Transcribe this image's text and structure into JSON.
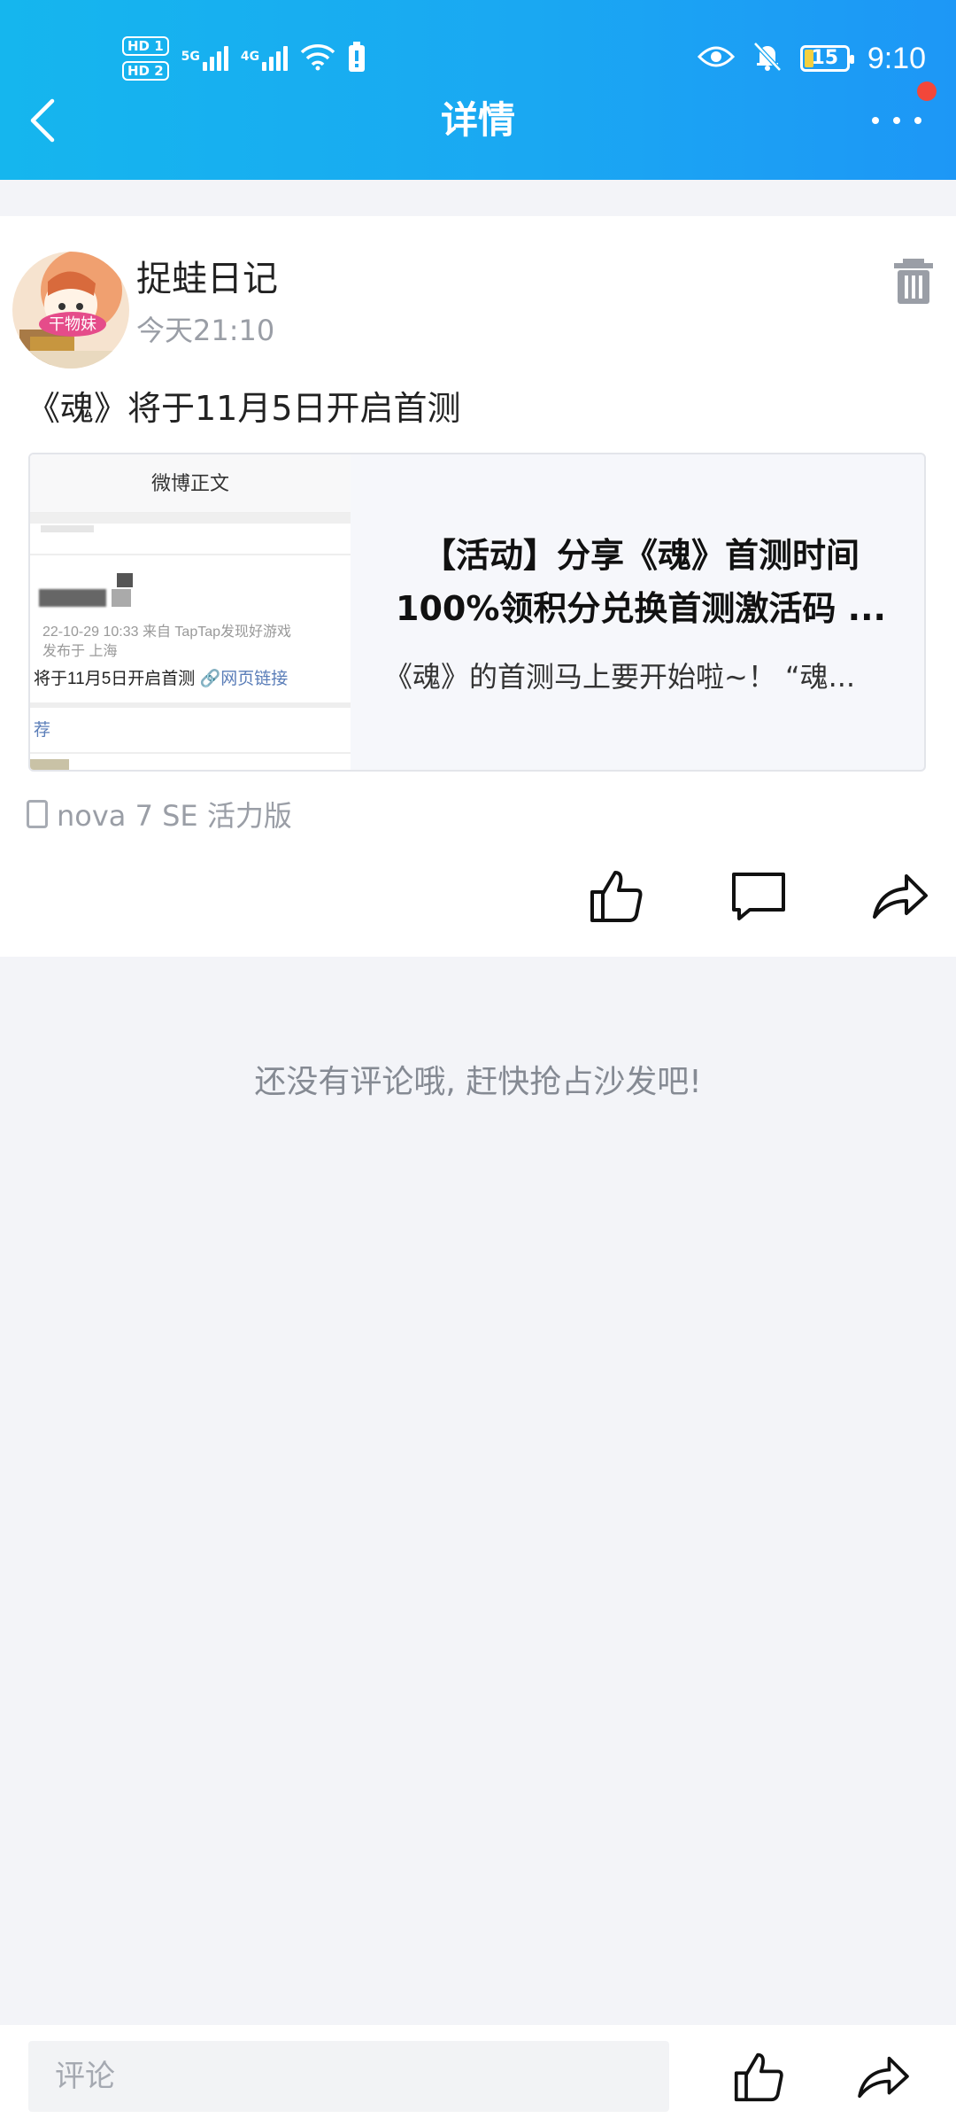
{
  "status_bar": {
    "sim1_label": "HD 1",
    "sim2_label": "HD 2",
    "net1_label": "5G",
    "net2_label": "4G",
    "battery_level": "15",
    "time": "9:10"
  },
  "nav": {
    "title": "详情"
  },
  "post": {
    "author": "捉蛙日记",
    "time": "今天21:10",
    "text": "《魂》将于11月5日开启首测",
    "link_card": {
      "title": "【活动】分享《魂》首测时间 100%领积分兑换首测激活码 ...",
      "description": "《魂》的首测马上要开始啦~！ “魂...",
      "thumbnail": {
        "header": "微博正文",
        "meta_time": "22-10-29 10:33  来自 TapTap发现好游戏",
        "meta_location": "发布于 上海",
        "line_text": "将于11月5日开启首测",
        "line_link": "网页链接",
        "tag": "荐"
      }
    },
    "device": "nova 7 SE  活力版"
  },
  "comments": {
    "empty_text": "还没有评论哦, 赶快抢占沙发吧!"
  },
  "bottom_bar": {
    "input_placeholder": "评论"
  },
  "colors": {
    "header_gradient_start": "#15b6ee",
    "header_gradient_end": "#1d97f6",
    "notification_dot": "#f2473a",
    "secondary_text": "#9a9ea6",
    "background": "#f3f4f8"
  },
  "icons": [
    "back-icon",
    "more-icon",
    "trash-icon",
    "like-icon",
    "comment-icon",
    "share-icon",
    "device-icon",
    "eye-icon",
    "mute-icon",
    "wifi-icon"
  ]
}
